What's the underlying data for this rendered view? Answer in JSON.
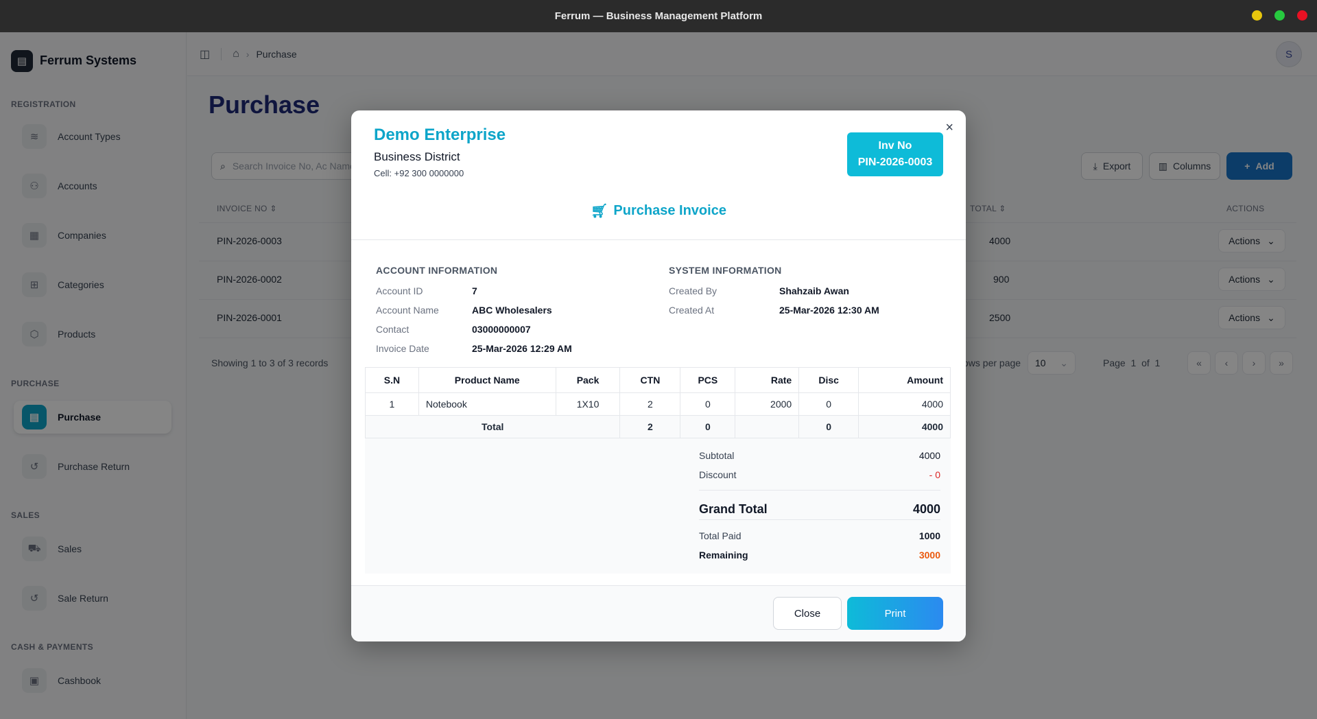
{
  "window": {
    "title": "Ferrum — Business Management Platform",
    "dots": [
      "#e8c60d",
      "#27c93f",
      "#e81123"
    ]
  },
  "brand": {
    "name": "Ferrum Systems",
    "icon": "building-icon"
  },
  "sidebar": {
    "sections": [
      {
        "label": "REGISTRATION"
      },
      {
        "label": "PURCHASE"
      },
      {
        "label": "SALES"
      },
      {
        "label": "CASH & PAYMENTS"
      }
    ],
    "items": [
      {
        "label": "Account Types",
        "icon": "layers-icon",
        "glyph": "≋"
      },
      {
        "label": "Accounts",
        "icon": "users-icon",
        "glyph": "⚇"
      },
      {
        "label": "Companies",
        "icon": "building-icon",
        "glyph": "▦"
      },
      {
        "label": "Categories",
        "icon": "tree-icon",
        "glyph": "⊞"
      },
      {
        "label": "Products",
        "icon": "package-icon",
        "glyph": "⬡"
      },
      {
        "label": "Purchase",
        "icon": "receipt-icon",
        "glyph": "▤"
      },
      {
        "label": "Purchase Return",
        "icon": "return-icon",
        "glyph": "↺"
      },
      {
        "label": "Sales",
        "icon": "cart-icon",
        "glyph": "⛟"
      },
      {
        "label": "Sale Return",
        "icon": "return-icon",
        "glyph": "↺"
      },
      {
        "label": "Cashbook",
        "icon": "wallet-icon",
        "glyph": "▣"
      }
    ]
  },
  "header": {
    "breadcrumb": "Purchase",
    "avatar": "S"
  },
  "main": {
    "title": "Purchase",
    "search_placeholder": "Search Invoice No, Ac Name...",
    "export_label": "Export",
    "columns_label": "Columns",
    "add_label": "Add",
    "columns": {
      "invoice_no": "INVOICE NO",
      "total": "TOTAL",
      "actions": "ACTIONS"
    },
    "rows": [
      {
        "invoice_no": "PIN-2026-0003",
        "total": "4000",
        "action": "Actions"
      },
      {
        "invoice_no": "PIN-2026-0002",
        "total": "900",
        "action": "Actions"
      },
      {
        "invoice_no": "PIN-2026-0001",
        "total": "2500",
        "action": "Actions"
      }
    ],
    "showing": "Showing 1 to 3 of 3 records",
    "rows_per_page_label": "ows per page",
    "rows_per_page_value": "10",
    "page_label": "Page",
    "page_current": "1",
    "page_of": "of",
    "page_total": "1"
  },
  "modal": {
    "company_name": "Demo Enterprise",
    "company_address": "Business District",
    "company_cell": "Cell: +92 300 0000000",
    "inv_label": "Inv No",
    "inv_number": "PIN-2026-0003",
    "heading": "Purchase Invoice",
    "account_title": "ACCOUNT INFORMATION",
    "system_title": "SYSTEM INFORMATION",
    "account": [
      {
        "label": "Account ID",
        "value": "7"
      },
      {
        "label": "Account Name",
        "value": "ABC Wholesalers"
      },
      {
        "label": "Contact",
        "value": "03000000007"
      },
      {
        "label": "Invoice Date",
        "value": "25-Mar-2026 12:29 AM"
      }
    ],
    "system": [
      {
        "label": "Created By",
        "value": "Shahzaib Awan"
      },
      {
        "label": "Created At",
        "value": "25-Mar-2026 12:30 AM"
      }
    ],
    "table": {
      "headers": [
        "S.N",
        "Product Name",
        "Pack",
        "CTN",
        "PCS",
        "Rate",
        "Disc",
        "Amount"
      ],
      "rows": [
        [
          "1",
          "Notebook",
          "1X10",
          "2",
          "0",
          "2000",
          "0",
          "4000"
        ]
      ],
      "total": {
        "label": "Total",
        "ctn": "2",
        "pcs": "0",
        "rate": "",
        "disc": "0",
        "amount": "4000"
      }
    },
    "summary": {
      "subtotal_label": "Subtotal",
      "subtotal": "4000",
      "discount_label": "Discount",
      "discount": "- 0",
      "grand_total_label": "Grand Total",
      "grand_total": "4000",
      "total_paid_label": "Total Paid",
      "total_paid": "1000",
      "remaining_label": "Remaining",
      "remaining": "3000"
    },
    "colors": {
      "accent": "#0ea5c9",
      "discount": "#dc2626",
      "remaining": "#ea580c"
    },
    "close_label": "Close",
    "print_label": "Print"
  }
}
